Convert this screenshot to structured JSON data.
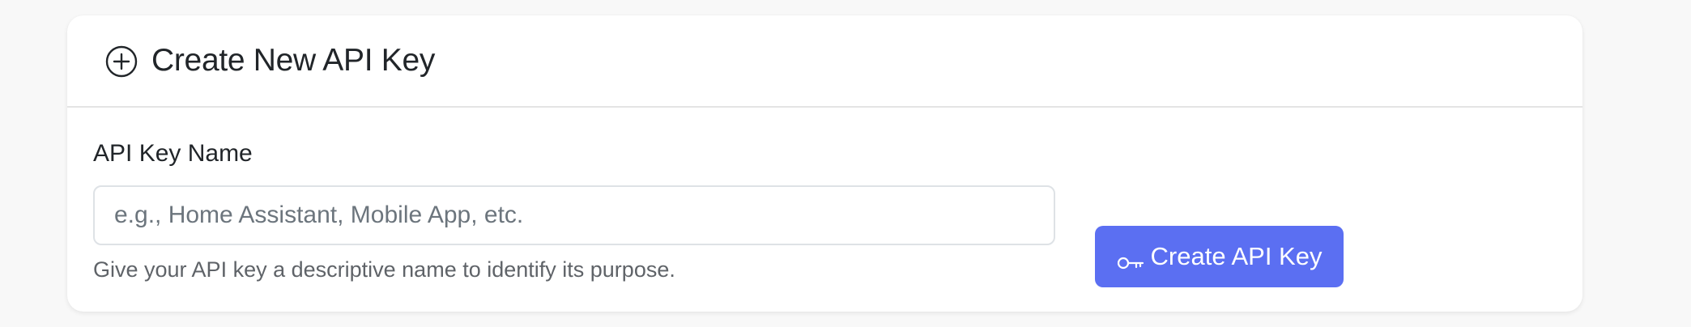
{
  "card": {
    "title": "Create New API Key",
    "header_icon": "plus-circle-icon"
  },
  "form": {
    "label": "API Key Name",
    "input_value": "",
    "input_placeholder": "e.g., Home Assistant, Mobile App, etc.",
    "help_text": "Give your API key a descriptive name to identify its purpose."
  },
  "button": {
    "icon": "key-icon",
    "label": "Create API Key"
  },
  "colors": {
    "accent": "#5b6ff2",
    "background": "#f8f8f8",
    "card": "#ffffff"
  }
}
